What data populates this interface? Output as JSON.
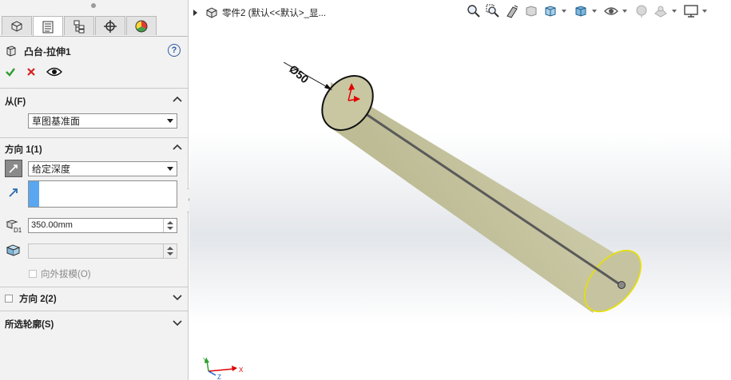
{
  "property_manager": {
    "tabs": [
      "feature-manager",
      "property-manager",
      "configuration-manager",
      "dimxpert-manager",
      "display-manager"
    ],
    "feature_title": "凸台-拉伸1",
    "help": "?",
    "from_section": {
      "title": "从(F)",
      "start_condition": "草图基准面"
    },
    "direction1": {
      "title": "方向 1(1)",
      "end_condition": "给定深度",
      "depth": "350.00mm",
      "draft_outward": "向外拔模(O)"
    },
    "direction2": {
      "title": "方向 2(2)"
    },
    "selected_contours": {
      "title": "所选轮廓(S)"
    }
  },
  "graphics": {
    "breadcrumb": "零件2  (默认<<默认>_显...",
    "dimension_label": "Ø50",
    "triad": {
      "x": "X",
      "y": "Y",
      "z": "Z"
    },
    "colors": {
      "cylinder": "#c9c8a3",
      "edge": "#1a1a1a",
      "selected_end": "#e8e000",
      "arrow": "#e00000"
    }
  }
}
